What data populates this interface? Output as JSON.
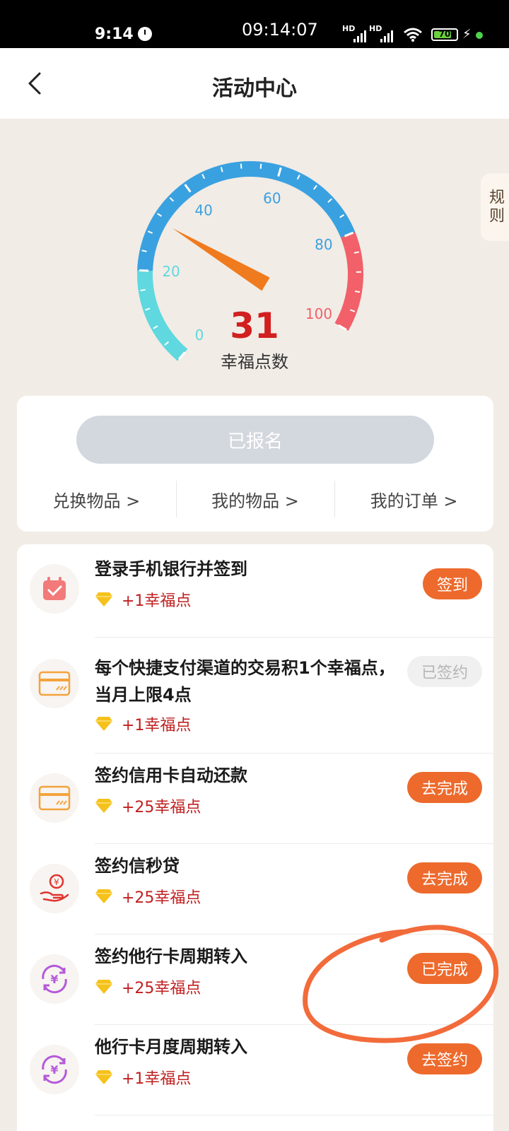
{
  "status_bar": {
    "time": "9:14",
    "center_time": "09:14:07",
    "signal_label_1": "HD",
    "signal_label_2": "HD",
    "battery": "70",
    "icons": [
      "clock-icon",
      "signal-icon",
      "wifi-icon",
      "battery-icon",
      "charging-icon"
    ]
  },
  "nav": {
    "title": "活动中心",
    "back_icon": "chevron-left-icon"
  },
  "rules_tab": {
    "label": "规则"
  },
  "gauge": {
    "min": 0,
    "max": 100,
    "value": 31,
    "value_label": "31",
    "caption": "幸福点数",
    "ticks": [
      "0",
      "20",
      "40",
      "60",
      "80",
      "100"
    ],
    "colors": {
      "low": "#5fd8df",
      "mid": "#3aa1e0",
      "high": "#f2606a",
      "needle": "#f07a1e",
      "value": "#d21f1f"
    }
  },
  "signup": {
    "button_label": "已报名",
    "links": [
      "兑换物品 >",
      "我的物品 >",
      "我的订单 >"
    ]
  },
  "tasks": [
    {
      "title": "登录手机银行并签到",
      "points": "+1幸福点",
      "button": "签到",
      "button_state": "active",
      "icon": "calendar-check-icon"
    },
    {
      "title": "每个快捷支付渠道的交易积1个幸福点，当月上限4点",
      "points": "+1幸福点",
      "button": "已签约",
      "button_state": "disabled",
      "icon": "card-icon"
    },
    {
      "title": "签约信用卡自动还款",
      "points": "+25幸福点",
      "button": "去完成",
      "button_state": "active",
      "icon": "card-icon"
    },
    {
      "title": "签约信秒贷",
      "points": "+25幸福点",
      "button": "去完成",
      "button_state": "active",
      "icon": "hand-coin-icon"
    },
    {
      "title": "签约他行卡周期转入",
      "points": "+25幸福点",
      "button": "已完成",
      "button_state": "active",
      "icon": "yuan-cycle-icon"
    },
    {
      "title": "他行卡月度周期转入",
      "points": "+1幸福点",
      "button": "去签约",
      "button_state": "active",
      "icon": "yuan-cycle-icon"
    }
  ],
  "colors": {
    "accent": "#ed6a2c",
    "points_text": "#c0201f",
    "disabled_button": "#f0f0f0",
    "page_bg": "#f1ece6"
  }
}
